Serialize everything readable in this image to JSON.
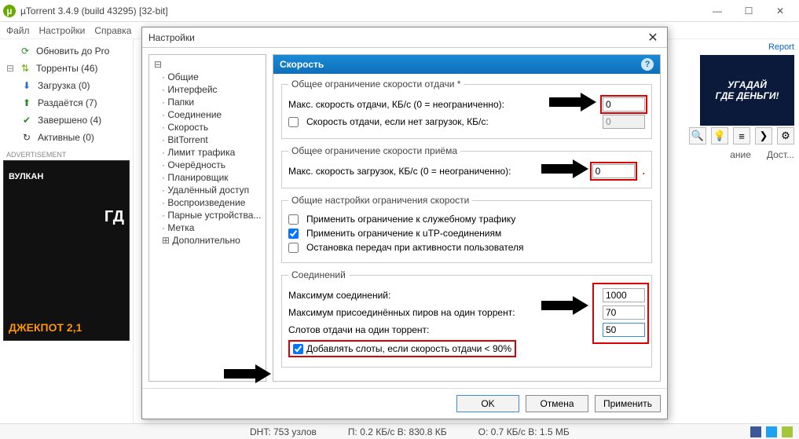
{
  "window": {
    "title": "µTorrent 3.4.9  (build 43295) [32-bit]"
  },
  "menubar": {
    "file": "Файл",
    "settings": "Настройки",
    "help": "Справка"
  },
  "sidebar": {
    "upgrade": "Обновить до Pro",
    "torrents": "Торренты (46)",
    "downloading": "Загрузка (0)",
    "seeding": "Раздаётся (7)",
    "completed": "Завершено (4)",
    "active": "Активные (0)",
    "ad_label": "ADVERTISEMENT",
    "ad_vulkan": "ВУЛКАН",
    "ad_jackpot": "ДЖЕКПОТ 2,1",
    "ad_gde": "ГД"
  },
  "right": {
    "report": "Report",
    "ad_line1": "УГАДАЙ",
    "ad_line2": "ГДЕ ДЕНЬГИ!",
    "col1": "ание",
    "col2": "Дост..."
  },
  "status": {
    "dht": "DHT: 753 узлов",
    "up": "П: 0.2 КБ/с В: 830.8 КБ",
    "down": "О: 0.7 КБ/с В: 1.5 МБ"
  },
  "dialog": {
    "title": "Настройки",
    "tree": {
      "general": "Общие",
      "interface": "Интерфейс",
      "folders": "Папки",
      "connection": "Соединение",
      "speed": "Скорость",
      "bittorrent": "BitTorrent",
      "bandwidth": "Лимит трафика",
      "queue": "Очерёдность",
      "scheduler": "Планировщик",
      "remote": "Удалённый доступ",
      "playback": "Воспроизведение",
      "paired": "Парные устройства...",
      "label": "Метка",
      "advanced": "Дополнительно"
    },
    "panel": {
      "title": "Скорость",
      "grp_upload": "Общее ограничение скорости отдачи *",
      "max_upload": "Макс. скорость отдачи, КБ/с (0 = неограниченно):",
      "max_upload_val": "0",
      "alt_upload": "Скорость отдачи, если нет загрузок, КБ/с:",
      "alt_upload_val": "0",
      "grp_download": "Общее ограничение скорости приёма",
      "max_download": "Макс. скорость загрузок, КБ/с (0 = неограниченно):",
      "max_download_val": "0",
      "grp_global": "Общие настройки ограничения скорости",
      "apply_overhead": "Применить ограничение к служебному трафику",
      "apply_utp": "Применить ограничение к uTP-соединениям",
      "stop_on_user": "Остановка передач при активности пользователя",
      "grp_conn": "Соединений",
      "max_conn": "Максимум соединений:",
      "max_conn_val": "1000",
      "max_peers": "Максимум присоединённых пиров на один торрент:",
      "max_peers_val": "70",
      "slots": "Слотов отдачи на один торрент:",
      "slots_val": "50",
      "add_slots": "Добавлять слоты, если скорость отдачи < 90%"
    },
    "buttons": {
      "ok": "OK",
      "cancel": "Отмена",
      "apply": "Применить"
    }
  }
}
